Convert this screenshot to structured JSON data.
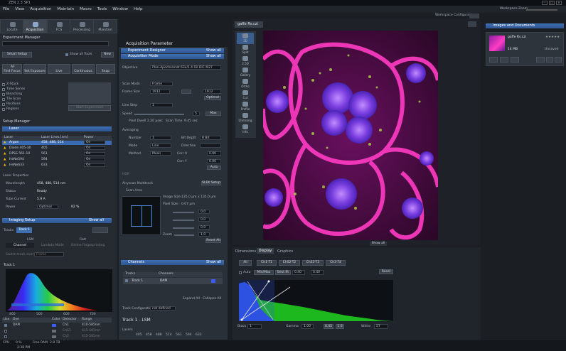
{
  "window": {
    "title": "ZEN 2.3 SP1"
  },
  "menu": [
    "File",
    "View",
    "Acquisition",
    "Maintain",
    "Macro",
    "Tools",
    "Window",
    "Help"
  ],
  "workspace": {
    "zoom_label": "Workspace Zoom",
    "config_label": "Workspace Configuration"
  },
  "main_tabs": [
    {
      "label": "Locate"
    },
    {
      "label": "Acquisition"
    },
    {
      "label": "FCS"
    },
    {
      "label": "Processing"
    },
    {
      "label": "Maintain"
    }
  ],
  "left": {
    "experiment_manager": "Experiment Manager",
    "smart_setup": "Smart Setup",
    "show_all_tools": "Show all Tools",
    "new": "New",
    "find_focus": "Find Focus",
    "set_exposure": "Set Exposure",
    "live": "Live",
    "continuous": "Continuous",
    "snap": "Snap",
    "af": "AF",
    "options": [
      "Z-Stack",
      "Time Series",
      "Bleaching",
      "Tile Scan",
      "Positions",
      "Regions"
    ],
    "start_experiment": "Start Experiment",
    "setup_manager": "Setup Manager",
    "laser_header": "Laser",
    "laser_cols": [
      "Laser",
      "Laser Lines [nm]",
      "Power"
    ],
    "lasers": [
      {
        "name": "Argon",
        "lines": "458, 488, 514",
        "power": "On"
      },
      {
        "name": "Diode 405-30",
        "lines": "405",
        "power": "On"
      },
      {
        "name": "DPSS 561-10",
        "lines": "561",
        "power": "On"
      },
      {
        "name": "HeNe594",
        "lines": "594",
        "power": "On"
      },
      {
        "name": "HeNe633",
        "lines": "633",
        "power": "On"
      }
    ],
    "laser_properties": "Laser Properties",
    "props": [
      {
        "k": "Wavelength",
        "v": "458, 488, 514 nm"
      },
      {
        "k": "Status",
        "v": "Ready"
      },
      {
        "k": "Tube Current",
        "v": "5.9 A"
      },
      {
        "k": "Power",
        "v": "Optimal"
      }
    ],
    "power_pct": "92 %",
    "imaging_setup": "Imaging Setup",
    "show_all": "Show all",
    "tracks_label": "Tracks",
    "track1": "Track 1",
    "lsm": "LSM",
    "fast": "Fast",
    "channel": "Channel",
    "lambda_mode": "Lambda Mode",
    "online_fp": "Online Fingerprinting",
    "switch_track": "Switch track every",
    "frame": "Frame",
    "track_title": "Track 1",
    "spectrum_ticks": [
      "400",
      "500",
      "600",
      "700"
    ],
    "dye_cols": [
      "Use",
      "Dye",
      "Color",
      "Detector",
      "Range"
    ],
    "dyes": [
      {
        "dye": "DAPI",
        "det": "Ch1",
        "range": "410-585nm"
      },
      {
        "dye": "",
        "det": "ChS1",
        "range": "415-585nm"
      },
      {
        "dye": "",
        "det": "Ch2",
        "range": "415-585nm"
      },
      {
        "dye": "",
        "det": "Ch3",
        "range": "415-585nm"
      }
    ]
  },
  "mid": {
    "acq_param": "Acquisition Parameter",
    "exp_designer": "Experiment Designer",
    "acq_mode": "Acquisition Mode",
    "show_all": "Show all",
    "objective_label": "Objective",
    "objective": "Plan-Apochromat 63x/1.4 Oil DIC M27",
    "scan_mode_label": "Scan Mode",
    "scan_mode": "Frame",
    "frame_size_label": "Frame Size",
    "frame_w": "1912",
    "frame_h": "1912",
    "optimal": "Optimal",
    "line_step_label": "Line Step",
    "line_step": "1",
    "speed_label": "Speed",
    "speed": "5",
    "max": "Max",
    "pixel_dwell": "Pixel Dwell",
    "pixel_dwell_val": "2.20 µsec",
    "scan_time": "Scan Time",
    "scan_time_val": "9.45 sec",
    "averaging": "Averaging",
    "number_label": "Number",
    "number": "1",
    "bit_depth_label": "Bit Depth",
    "bit_depth": "8 Bit",
    "mode_label": "Mode",
    "mode": "Line",
    "direction_label": "Direction",
    "method_label": "Method",
    "method": "Mean",
    "corr_x": "Corr X",
    "corr_y": "Corr Y",
    "corr_val": "0.00",
    "auto": "Auto",
    "hdr": "HDR",
    "airyscan": "Airyscan Multitrack",
    "sr": "SLEK Setup",
    "scan_area": "Scan Area",
    "img_size_label": "Image Size:",
    "img_size": "135.0 µm x 135.0 µm",
    "pixel_size_label": "Pixel Size:",
    "pixel_size": "0.07 µm",
    "zoom_label": "Zoom",
    "zoom_val": "1.0",
    "reset_all": "Reset All",
    "offsets": [
      "0.0",
      "0.0",
      "0.0"
    ],
    "channels": "Channels",
    "tracks_col": "Tracks",
    "channels_col": "Channels",
    "ch_track1": "Track 1",
    "ch_dapi": "DAPI",
    "expand_all": "Expand All",
    "collapse_all": "Collapse All",
    "track_config_label": "Track Configuration",
    "track_config": "not defined",
    "track_title": "Track 1 - LSM",
    "lasers_label": "Lasers",
    "laser_lines": [
      "405",
      "458",
      "488",
      "514",
      "561",
      "594",
      "633"
    ]
  },
  "image": {
    "tab": "gaffe Rs.czi",
    "side": [
      "2D",
      "Split",
      "2.5D",
      "Gallery",
      "Ortho",
      "Cut",
      "Profile",
      "Unmixing",
      "Info"
    ],
    "show_all": "Show all"
  },
  "dims": {
    "tabs": [
      "Dimensions",
      "Display",
      "Graphics"
    ],
    "channel_tabs": [
      "All",
      "Ch1-T1",
      "ChS2-T2",
      "ChS3-T3",
      "Ch3-T4"
    ],
    "auto": "Auto",
    "minmax": "Min/Max",
    "bestfit": "Best fit",
    "v1": "0.40",
    "v2": "0.40",
    "reset": "Reset",
    "black_label": "Black",
    "black": "1",
    "gamma_label": "Gamma",
    "gamma": "1.00",
    "gamma2": "0.45",
    "gamma3": "1.0",
    "white_label": "White",
    "white": "57"
  },
  "right": {
    "title": "Images and Documents",
    "doc_name": "gaffe Rs.czi",
    "doc_size": "14 MB",
    "doc_state": "Unsaved"
  },
  "status": {
    "cpu": "CPU",
    "free_ram": "Free RAM",
    "cpu_val": "0 %",
    "ram_val": "2.8 TB",
    "time": "2:38 PM"
  }
}
